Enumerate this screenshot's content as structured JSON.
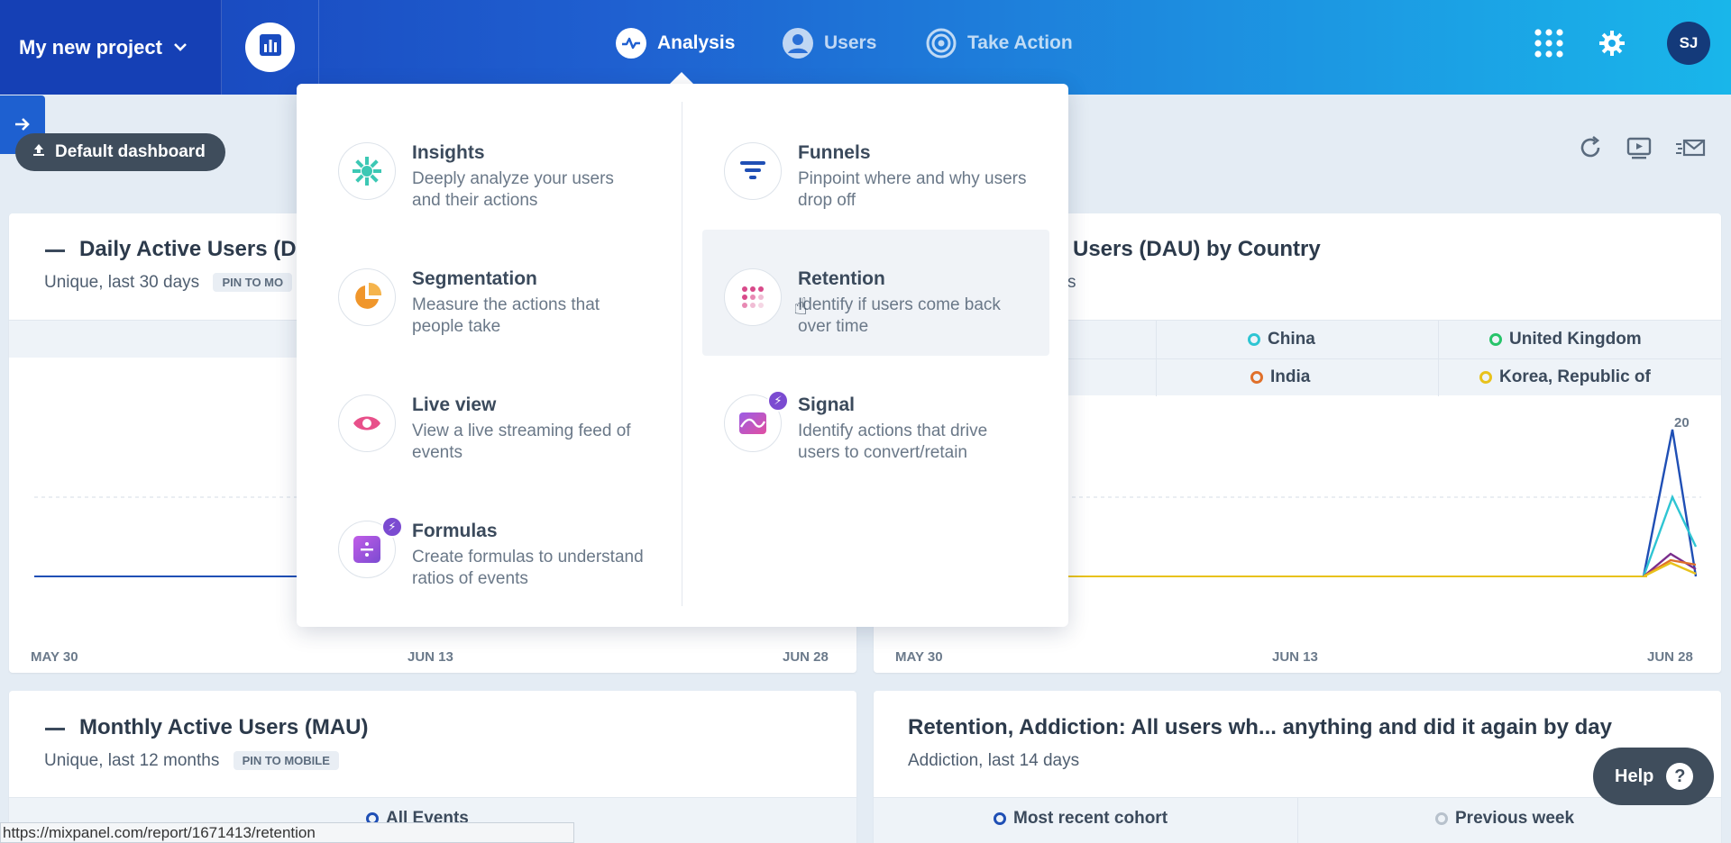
{
  "header": {
    "project": "My new project",
    "nav": [
      {
        "label": "Analysis",
        "icon": "pulse-icon",
        "active": true
      },
      {
        "label": "Users",
        "icon": "user-circle-icon",
        "active": false
      },
      {
        "label": "Take Action",
        "icon": "target-icon",
        "active": false
      }
    ],
    "avatar": "SJ"
  },
  "dashboard": {
    "label": "Default dashboard"
  },
  "cards": {
    "dau": {
      "title": "Daily Active Users (D",
      "subtitle": "Unique, last 30 days",
      "pin": "PIN TO MO",
      "x_ticks": [
        "MAY 30",
        "JUN 13",
        "JUN 28"
      ]
    },
    "dau_country": {
      "title": "Users (DAU) by Country",
      "subtitle": "s",
      "legend": [
        {
          "label": "China",
          "color": "#2ec5d3"
        },
        {
          "label": "United Kingdom",
          "color": "#27c46a"
        },
        {
          "label": "India",
          "color": "#e0702b"
        },
        {
          "label": "Korea, Republic of",
          "color": "#e8c21c"
        }
      ],
      "peak_label": "20",
      "x_ticks": [
        "MAY 30",
        "JUN 13",
        "JUN 28"
      ]
    },
    "mau": {
      "title": "Monthly Active Users (MAU)",
      "subtitle": "Unique, last 12 months",
      "pin": "PIN TO MOBILE",
      "legend": "All Events"
    },
    "retention": {
      "title": "Retention, Addiction: All users wh... anything and did it again by day",
      "subtitle": "Addiction, last 14 days",
      "legend": [
        "Most recent cohort",
        "Previous week"
      ]
    }
  },
  "menu": {
    "left": [
      {
        "title": "Insights",
        "desc": "Deeply analyze your users and their actions",
        "icon": "insights-icon"
      },
      {
        "title": "Segmentation",
        "desc": "Measure the actions that people take",
        "icon": "pie-chart-icon"
      },
      {
        "title": "Live view",
        "desc": "View a live streaming feed of events",
        "icon": "eye-icon"
      },
      {
        "title": "Formulas",
        "desc": "Create formulas to understand ratios of events",
        "icon": "divide-icon"
      }
    ],
    "right": [
      {
        "title": "Funnels",
        "desc": "Pinpoint where and why users drop off",
        "icon": "funnel-icon"
      },
      {
        "title": "Retention",
        "desc": "Identify if users come back over time",
        "icon": "dots-grid-icon"
      },
      {
        "title": "Signal",
        "desc": "Identify actions that drive users to convert/retain",
        "icon": "wave-icon"
      }
    ]
  },
  "help": "Help",
  "status_url": "https://mixpanel.com/report/1671413/retention"
}
